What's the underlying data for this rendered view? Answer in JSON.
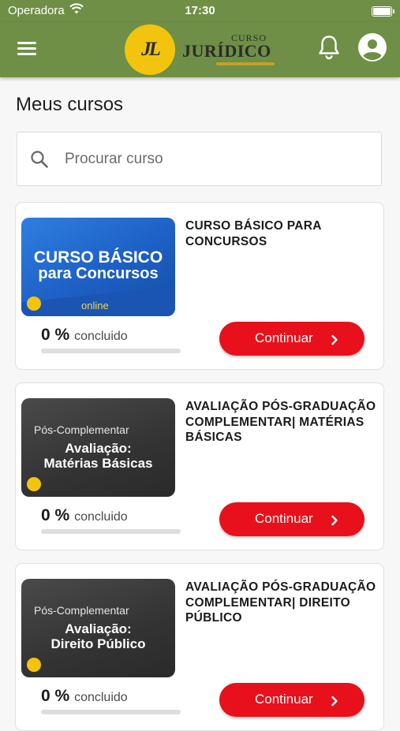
{
  "status_bar": {
    "carrier": "Operadora",
    "time": "17:30"
  },
  "header": {
    "logo": {
      "mark": "JL",
      "curso": "CURSO",
      "juridico": "JURÍDICO"
    },
    "icons": [
      "menu-icon",
      "bell-icon",
      "account-icon"
    ]
  },
  "page_title": "Meus cursos",
  "search": {
    "placeholder": "Procurar curso",
    "value": ""
  },
  "courses": [
    {
      "title": "CURSO BÁSICO PARA CONCURSOS",
      "thumb": {
        "line1": "CURSO BÁSICO",
        "line2": "para Concursos",
        "tag": "online"
      },
      "progress_value": "0",
      "progress_unit": "%",
      "progress_label": "concluido",
      "progress_fraction": 0,
      "button_label": "Continuar"
    },
    {
      "title": " AVALIAÇÃO PÓS-GRADUAÇÃO COMPLEMENTAR| MATÉRIAS BÁSICAS",
      "thumb": {
        "sub": "Pós-Complementar",
        "line1": "Avaliação:",
        "line2": "Matérias Básicas"
      },
      "progress_value": "0",
      "progress_unit": "%",
      "progress_label": "concluido",
      "progress_fraction": 0,
      "button_label": "Continuar"
    },
    {
      "title": "AVALIAÇÃO PÓS-GRADUAÇÃO COMPLEMENTAR| DIREITO PÚBLICO",
      "thumb": {
        "sub": "Pós-Complementar",
        "line1": "Avaliação:",
        "line2": "Direito Público"
      },
      "progress_value": "0",
      "progress_unit": "%",
      "progress_label": "concluido",
      "progress_fraction": 0,
      "button_label": "Continuar"
    }
  ],
  "colors": {
    "header": "#6e8f45",
    "accent": "#e8101a",
    "logo_yellow": "#f2c40e"
  }
}
